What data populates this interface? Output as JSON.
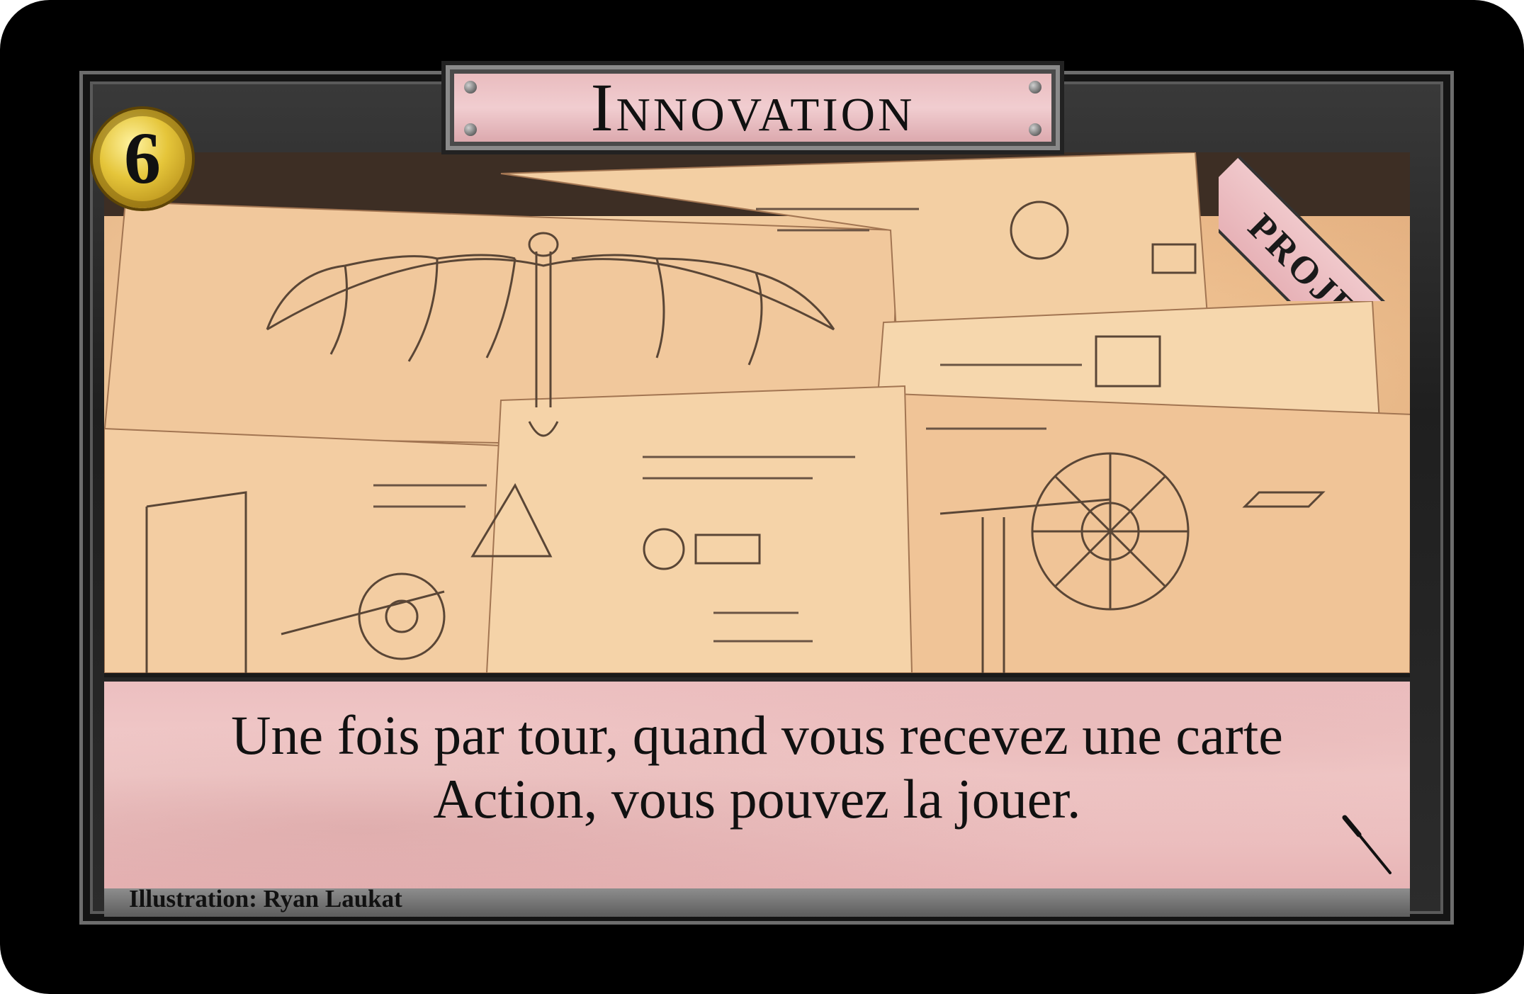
{
  "card": {
    "title": "Innovation",
    "cost": "6",
    "type": "PROJET",
    "text": "Une fois par tour, quand vous recevez une carte Action, vous pouvez la jouer.",
    "credit": "Illustration: Ryan Laukat",
    "colors": {
      "banner": "#f1cdd0",
      "coin": "#e5c53a",
      "frame": "#2c2c2c",
      "parchment": "#f3d2a8"
    },
    "icons": [
      "coin-icon",
      "paintbrush-icon"
    ]
  }
}
